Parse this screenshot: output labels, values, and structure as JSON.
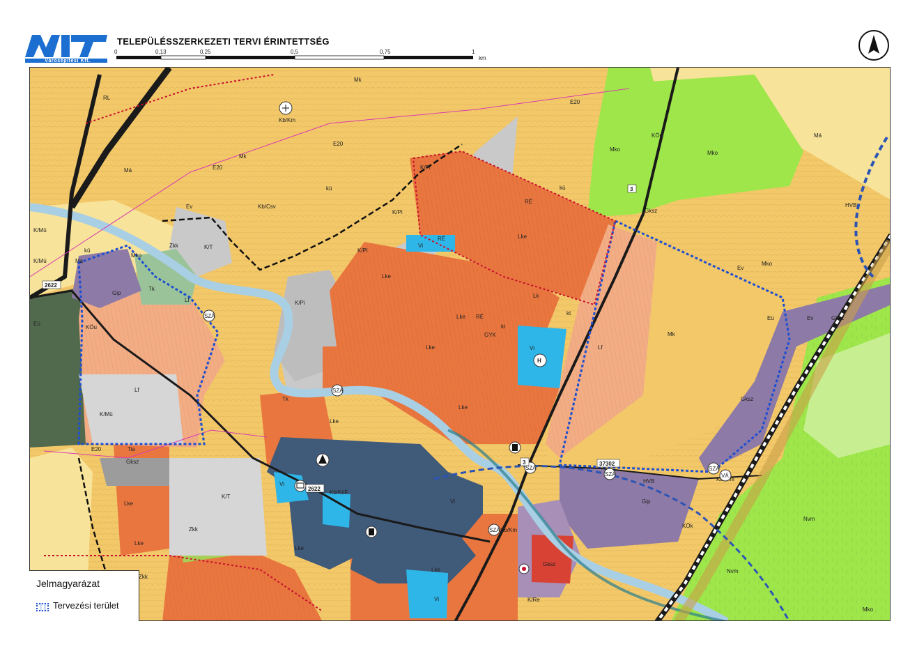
{
  "header": {
    "company": "Városépítési Kft.",
    "title": "TELEPÜLÉSSZERKEZETI TERVI ÉRINTETTSÉG",
    "scale_ticks": [
      "0",
      "0,13",
      "0,25",
      "0,5",
      "0,75",
      "1"
    ],
    "scale_unit": "km"
  },
  "legend": {
    "title": "Jelmagyarázat",
    "item": "Tervezési terület"
  },
  "roads": {
    "r2622_west": "2622",
    "r2622_center": "2622",
    "r3_north": "3",
    "r3_south": "3",
    "r37302": "37302"
  },
  "zones": {
    "mk": "Mk",
    "ma": "Má",
    "mko": "Mko",
    "kou": "KÖu",
    "ev": "Ev",
    "gksz": "Gksz",
    "kp": "K/Pi",
    "lke": "Lke",
    "lf": "Lf",
    "vi": "Vi",
    "gip": "Gip",
    "tk": "Tk",
    "zkk": "Zkk",
    "kmu": "K/Mü",
    "egy": "Eü",
    "kt": "K/T",
    "kbcsv": "Kb/Csv",
    "kbkm": "Kb/Km",
    "kbkif": "Kb/Ki/F",
    "kre": "K/Re",
    "kok": "KÖk",
    "lk": "Lk",
    "kbkmi": "Kb/Kmi",
    "sza": "SZÁ",
    "va": "VÁ",
    "ku": "kü",
    "kt_small": "kt",
    "e20": "E20",
    "hvb": "HVB",
    "nvm": "Nvm",
    "re": "RÉ",
    "rl": "RL",
    "gyk": "GYK",
    "h": "H",
    "tia": "Tia"
  },
  "colors": {
    "mk_orange": "#f3c869",
    "ma_yellow": "#f7e399",
    "forest_green": "#9ee64a",
    "meadow_green": "#c7ef92",
    "lke_orange": "#e9763f",
    "lf_salmon": "#f2ad84",
    "vi_blue": "#2fb6e8",
    "vi_dark": "#405a7a",
    "gip_purple": "#8e7aa6",
    "kp_grey": "#c9c9c9",
    "road_dark": "#1a1a1a",
    "river_blue": "#a9cfe4",
    "planning_border": "#1f4fd1"
  }
}
